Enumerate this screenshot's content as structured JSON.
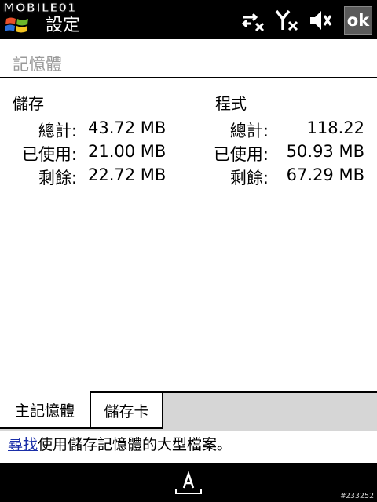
{
  "watermark": "MOBILE01",
  "window": {
    "title": "設定",
    "ok_label": "ok"
  },
  "page": {
    "title": "記憶體"
  },
  "storage": {
    "heading": "儲存",
    "rows": [
      {
        "label": "總計:",
        "value": "43.72 MB"
      },
      {
        "label": "已使用:",
        "value": "21.00 MB"
      },
      {
        "label": "剩餘:",
        "value": "22.72 MB"
      }
    ]
  },
  "program": {
    "heading": "程式",
    "rows": [
      {
        "label": "總計:",
        "value": "118.22"
      },
      {
        "label": "已使用:",
        "value": "50.93 MB"
      },
      {
        "label": "剩餘:",
        "value": "67.29 MB"
      }
    ]
  },
  "tabs": [
    {
      "label": "主記憶體",
      "active": true
    },
    {
      "label": "儲存卡",
      "active": false
    }
  ],
  "help": {
    "link": "尋找",
    "text": "使用儲存記憶體的大型檔案。"
  },
  "image_id": "#233252",
  "icons": {
    "start": "windows-start-icon",
    "connectivity": "connectivity-off-icon",
    "signal": "signal-off-icon",
    "volume": "volume-off-icon",
    "keyboard": "keyboard-sip-icon"
  }
}
